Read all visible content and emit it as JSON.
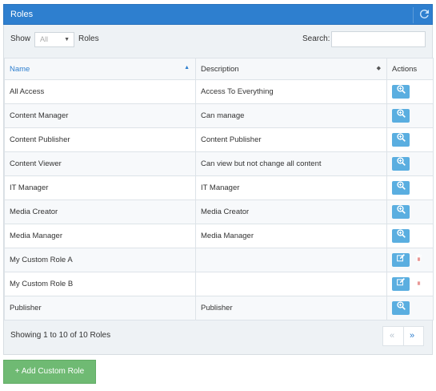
{
  "panel": {
    "title": "Roles"
  },
  "toolbar": {
    "show_label": "Show",
    "page_size_value": "All",
    "roles_label": "Roles",
    "search_label": "Search:",
    "search_value": ""
  },
  "table": {
    "headers": {
      "name": "Name",
      "description": "Description",
      "actions": "Actions"
    },
    "rows": [
      {
        "name": "All Access",
        "description": "Access To Everything",
        "actions": [
          "view"
        ]
      },
      {
        "name": "Content Manager",
        "description": "Can manage",
        "actions": [
          "view"
        ]
      },
      {
        "name": "Content Publisher",
        "description": "Content Publisher",
        "actions": [
          "view"
        ]
      },
      {
        "name": "Content Viewer",
        "description": "Can view but not change all content",
        "actions": [
          "view"
        ]
      },
      {
        "name": "IT Manager",
        "description": "IT Manager",
        "actions": [
          "view"
        ]
      },
      {
        "name": "Media Creator",
        "description": "Media Creator",
        "actions": [
          "view"
        ]
      },
      {
        "name": "Media Manager",
        "description": "Media Manager",
        "actions": [
          "view"
        ]
      },
      {
        "name": "My Custom Role A",
        "description": "",
        "actions": [
          "edit",
          "delete"
        ]
      },
      {
        "name": "My Custom Role B",
        "description": "",
        "actions": [
          "edit",
          "delete"
        ]
      },
      {
        "name": "Publisher",
        "description": "Publisher",
        "actions": [
          "view"
        ]
      }
    ]
  },
  "footer": {
    "info": "Showing 1 to 10 of 10 Roles",
    "prev": "«",
    "next": "»"
  },
  "add_button": {
    "label": "+ Add Custom Role"
  },
  "colors": {
    "header_bg": "#2e7fcf",
    "view_btn": "#5aaee0",
    "delete_btn": "#d9534f",
    "add_btn": "#6fba73"
  },
  "icons": {
    "refresh": "refresh-icon",
    "view": "zoom-in-icon",
    "edit": "edit-icon",
    "delete": "trash-icon",
    "sort_asc": "sort-asc-icon",
    "sort_both": "sort-both-icon"
  }
}
